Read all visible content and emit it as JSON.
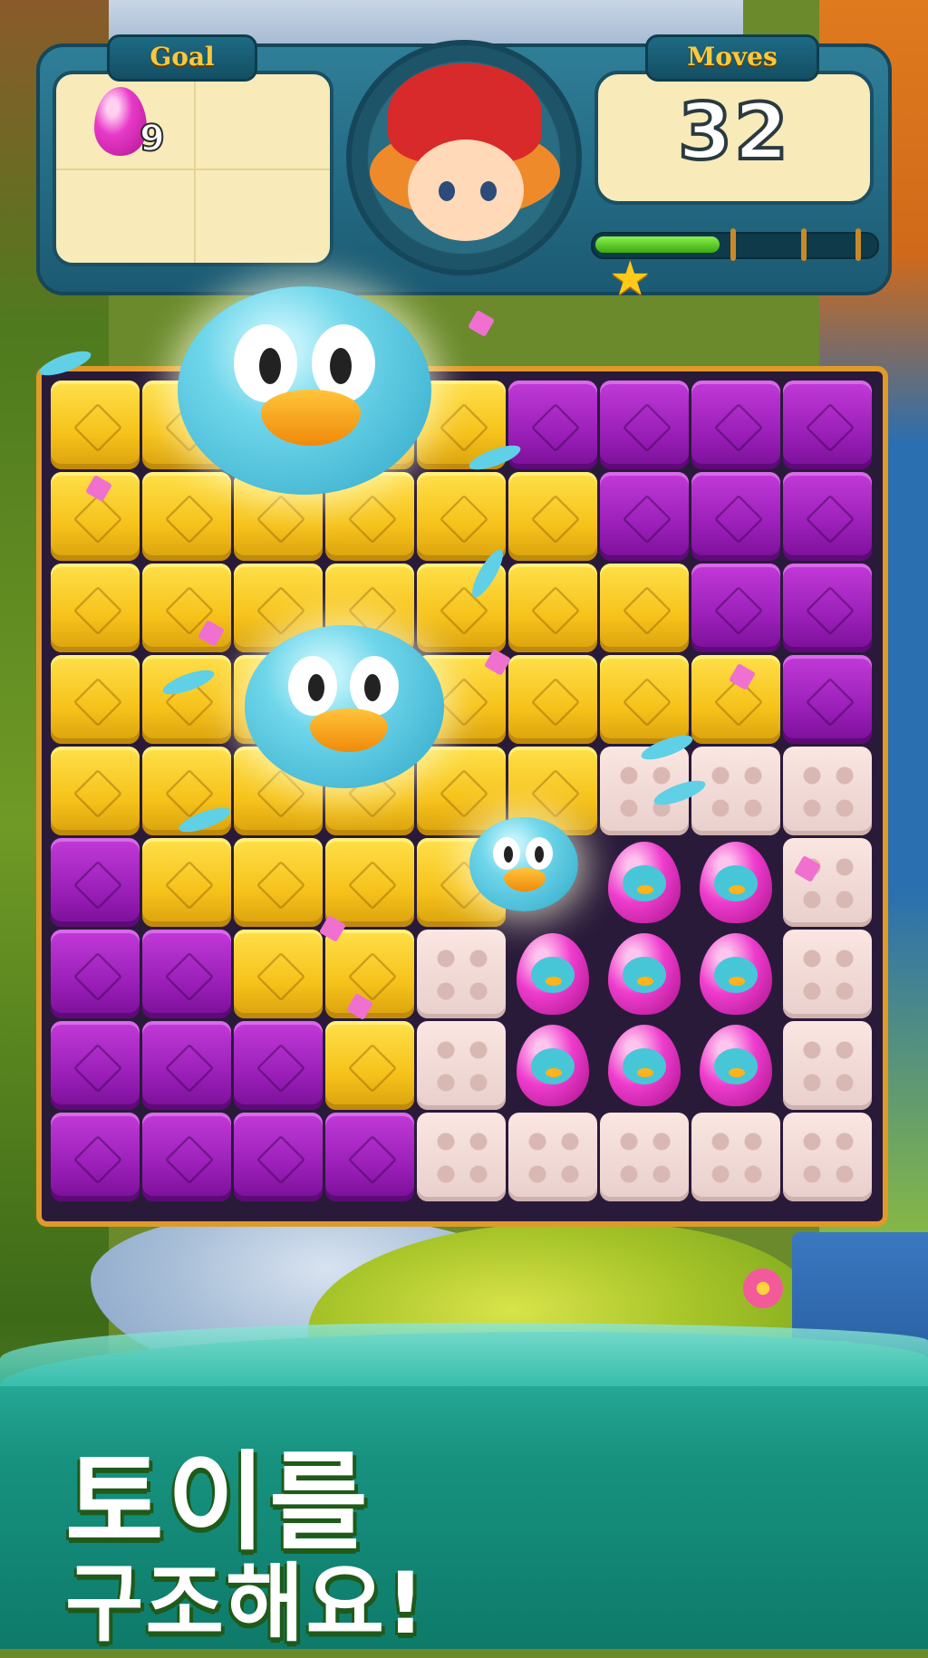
{
  "hud": {
    "goal_label": "Goal",
    "moves_label": "Moves",
    "goal_item": {
      "icon": "pink-egg-icon",
      "count": "9"
    },
    "moves_value": "32",
    "progress_fraction": 0.45
  },
  "board": {
    "columns": 9,
    "rows": 9,
    "legend": {
      "Y": "yellow-block",
      "P": "purple-block",
      "K": "pink-brick",
      "E": "egg-toy",
      "O": "open-space"
    },
    "grid": [
      "YYYYYPPPP",
      "YYYYYYPPP",
      "YYYYYYYPP",
      "YYYYYYYYP",
      "YYYYYYKKK",
      "PYYYYOEEK",
      "PPYYKEEEK",
      "PPPYKEEEK",
      "PPPPKKKKK"
    ]
  },
  "banner": {
    "line1": "토이를",
    "line2": "구조해요!"
  },
  "colors": {
    "yellow": "#f6c21a",
    "purple": "#9a1fb8",
    "pink_brick": "#f1ddd9",
    "hud": "#2f7e98",
    "banner": "#17927f"
  }
}
